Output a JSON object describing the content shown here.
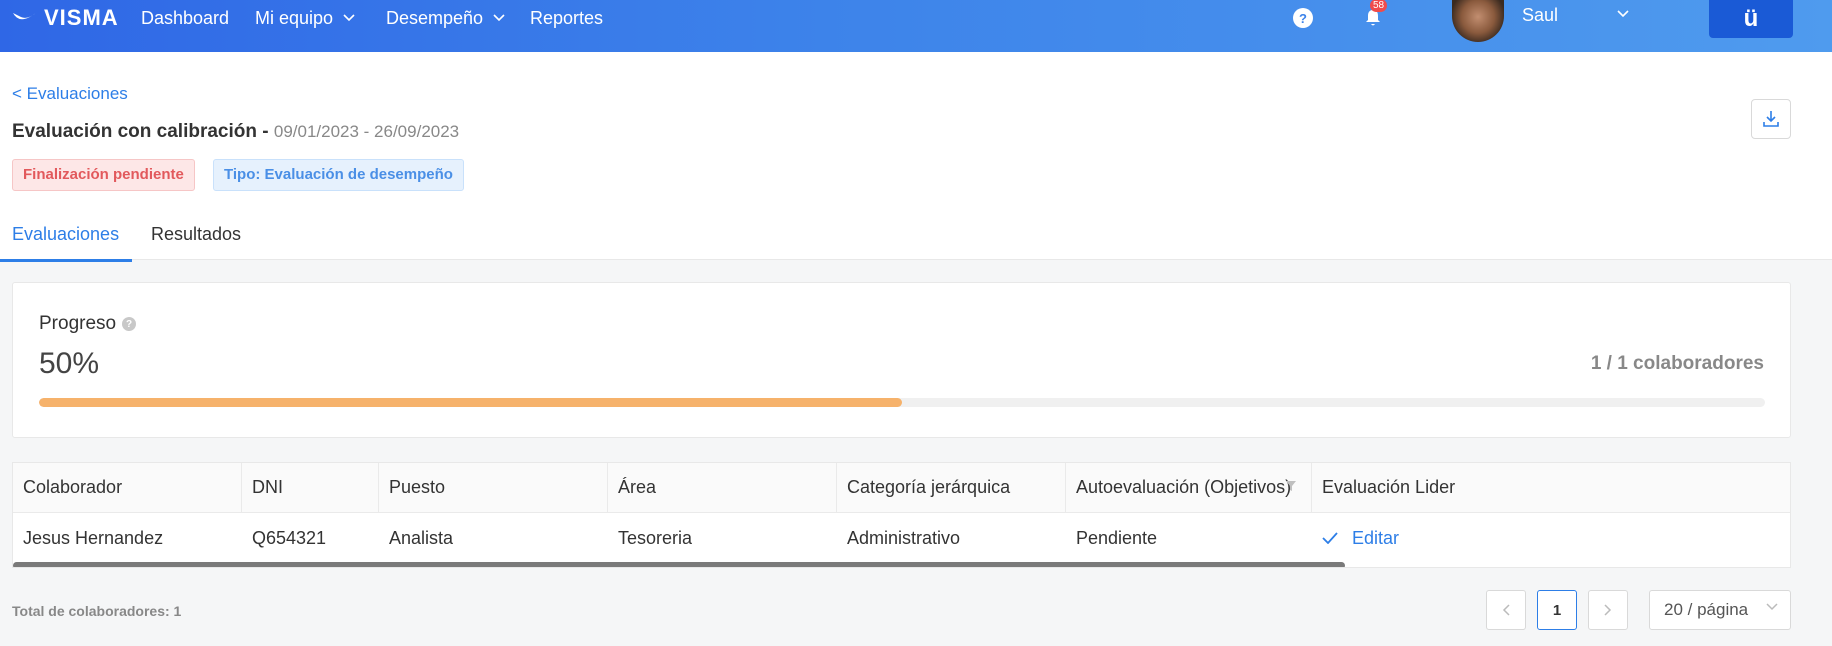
{
  "nav": {
    "logo": "VISMA",
    "items": [
      {
        "label": "Dashboard",
        "has_menu": false
      },
      {
        "label": "Mi equipo",
        "has_menu": true
      },
      {
        "label": "Desempeño",
        "has_menu": true
      },
      {
        "label": "Reportes",
        "has_menu": false
      }
    ],
    "help_icon": "?",
    "notifications_count": "58",
    "user_name": "Saul",
    "app_button": "ü"
  },
  "header": {
    "back_link": "< Evaluaciones",
    "title": "Evaluación con calibración",
    "separator": " - ",
    "dates": "09/01/2023 - 26/09/2023",
    "tags": {
      "status": "Finalización pendiente",
      "type": "Tipo: Evaluación de desempeño"
    }
  },
  "tabs": [
    "Evaluaciones",
    "Resultados"
  ],
  "progress": {
    "label": "Progreso",
    "value": "50%",
    "fraction": 0.5,
    "count": "1 / 1 colaboradores"
  },
  "table": {
    "columns": [
      "Colaborador",
      "DNI",
      "Puesto",
      "Área",
      "Categoría jerárquica",
      "Autoevaluación (Objetivos)",
      "Evaluación Lider"
    ],
    "rows": [
      [
        "Jesus Hernandez",
        "Q654321",
        "Analista",
        "Tesoreria",
        "Administrativo",
        "Pendiente",
        "Editar"
      ]
    ]
  },
  "footer": {
    "total": "Total de colaboradores: 1",
    "current_page": "1",
    "page_size": "20 / página"
  },
  "colors": {
    "accent": "#2d7ee7",
    "progress": "#f6b26b",
    "pending_tag": "#e2595c"
  }
}
